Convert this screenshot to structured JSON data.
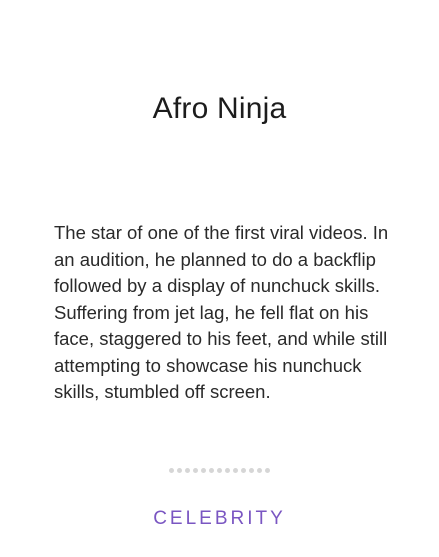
{
  "card": {
    "title": "Afro Ninja",
    "description": "The star of one of the first viral videos. In an audition, he planned to do a backflip followed by a display of nunchuck skills. Suffering from jet lag, he fell flat on his face, staggered to his feet, and while still attempting to showcase his nunchuck skills, stumbled off screen.",
    "category": "CELEBRITY",
    "pager": {
      "dot_count": 13
    }
  },
  "colors": {
    "background": "#ffffff",
    "title": "#1c1c1c",
    "text": "#2a2a2a",
    "dot": "#d6d6d6",
    "category": "#7a56c2"
  }
}
